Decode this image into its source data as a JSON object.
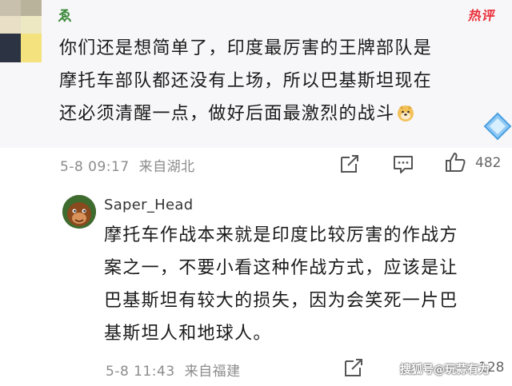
{
  "main_comment": {
    "username": "ゑ",
    "badge": "热评",
    "lines": [
      "你们还是想简单了，印度最厉害的王牌部队是",
      "摩托车部队都还没有上场，所以巴基斯坦现在",
      "还必须清醒一点，做好后面最激烈的战斗"
    ],
    "emoji": "doge-emoji",
    "time": "5-8 09:17",
    "location": "来自湖北",
    "like_count": "482"
  },
  "reply": {
    "username": "Saper_Head",
    "lines": [
      "摩托车作战本来就是印度比较厉害的作战方",
      "案之一，不要小看这种作战方式，应该是让",
      "巴基斯坦有较大的损失，因为会笑死一片巴",
      "基斯坦人和地球人。"
    ],
    "time": "5-8 11:43",
    "location": "来自福建",
    "like_count": "128"
  },
  "watermark": "搜狐号@玩蒜有力",
  "colors": {
    "badge": "#ea2f3a",
    "username_main": "#3c8a3c",
    "meta": "#8c8c8c"
  }
}
